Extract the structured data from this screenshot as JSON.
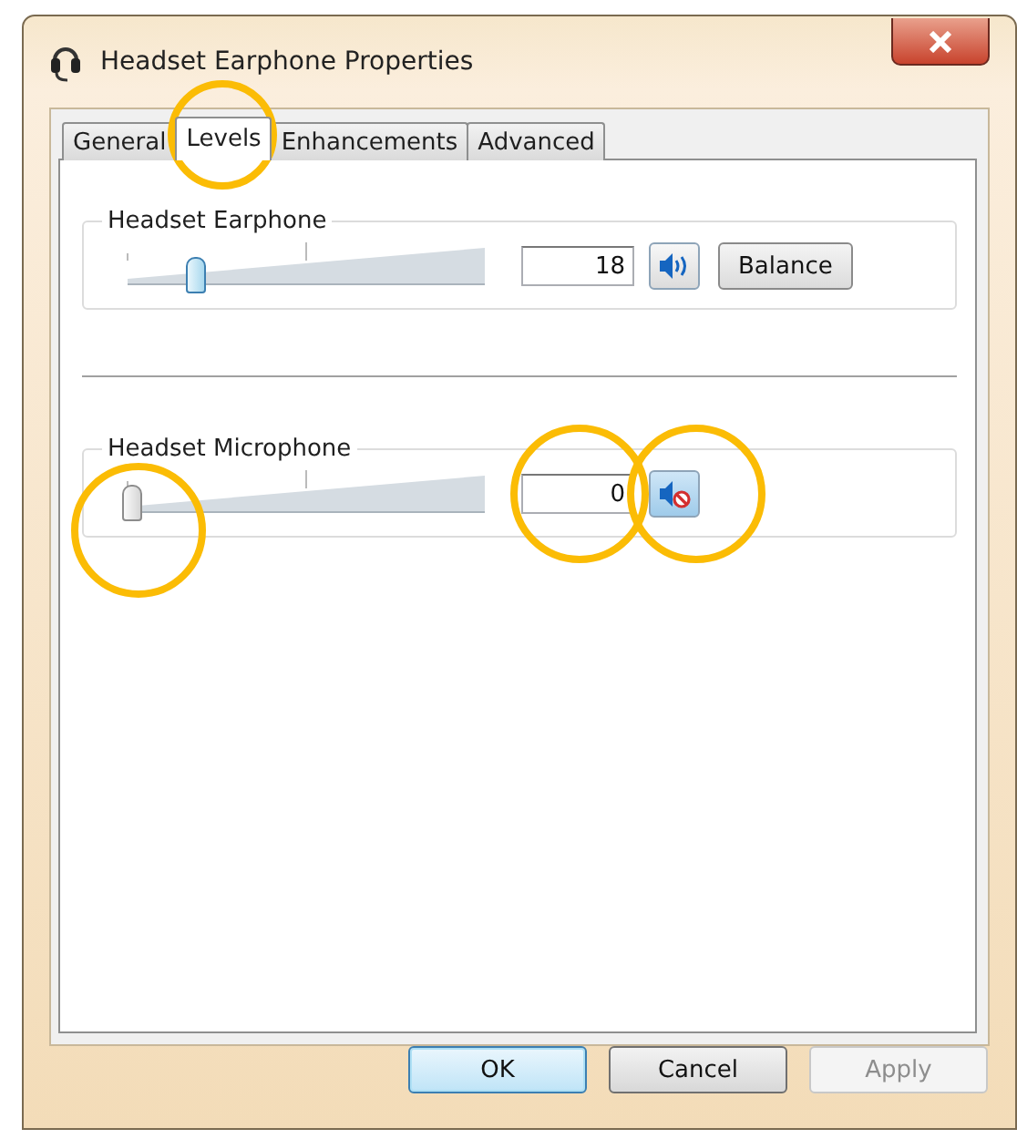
{
  "window": {
    "title": "Headset Earphone Properties"
  },
  "tabs": [
    {
      "label": "General",
      "selected": false,
      "highlighted": false
    },
    {
      "label": "Levels",
      "selected": true,
      "highlighted": true
    },
    {
      "label": "Enhancements",
      "selected": false,
      "highlighted": false
    },
    {
      "label": "Advanced",
      "selected": false,
      "highlighted": false
    }
  ],
  "devices": [
    {
      "name": "Headset Earphone",
      "level": 0.18,
      "value": "18",
      "muted": false,
      "balance_button": "Balance",
      "slider_highlighted": false,
      "value_highlighted": false,
      "mute_highlighted": false
    },
    {
      "name": "Headset Microphone",
      "level": 0,
      "value": "0",
      "muted": true,
      "slider_highlighted": true,
      "value_highlighted": true,
      "mute_highlighted": true
    }
  ],
  "buttons": [
    {
      "label": "OK",
      "kind": "default",
      "disabled": false
    },
    {
      "label": "Cancel",
      "kind": "normal",
      "disabled": false
    },
    {
      "label": "Apply",
      "kind": "normal",
      "disabled": true
    }
  ]
}
